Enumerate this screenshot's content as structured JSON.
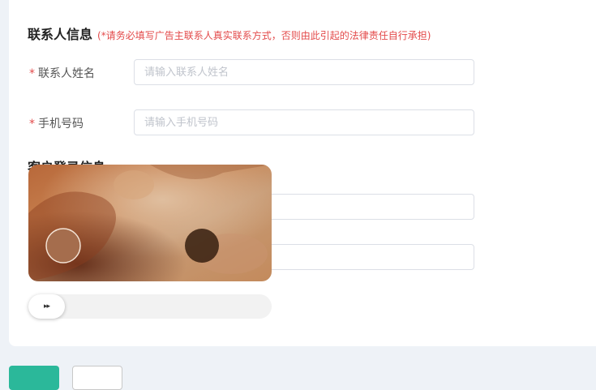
{
  "contact_section": {
    "title": "联系人信息",
    "note": "(*请务必填写广告主联系人真实联系方式，否则由此引起的法律责任自行承担)"
  },
  "fields": {
    "contact_name": {
      "required_mark": "*",
      "label": "联系人姓名",
      "placeholder": "请输入联系人姓名",
      "value": ""
    },
    "phone": {
      "required_mark": "*",
      "label": "手机号码",
      "placeholder": "请输入手机号码",
      "value": ""
    }
  },
  "login_section": {
    "title": "客户登录信息"
  },
  "captcha": {
    "slider_icon": "double-chevron-right-icon",
    "slider_glyph": "▸▸",
    "slider_progress": 0
  },
  "colors": {
    "required": "#e34a4a",
    "primary_button": "#2bb89a"
  }
}
